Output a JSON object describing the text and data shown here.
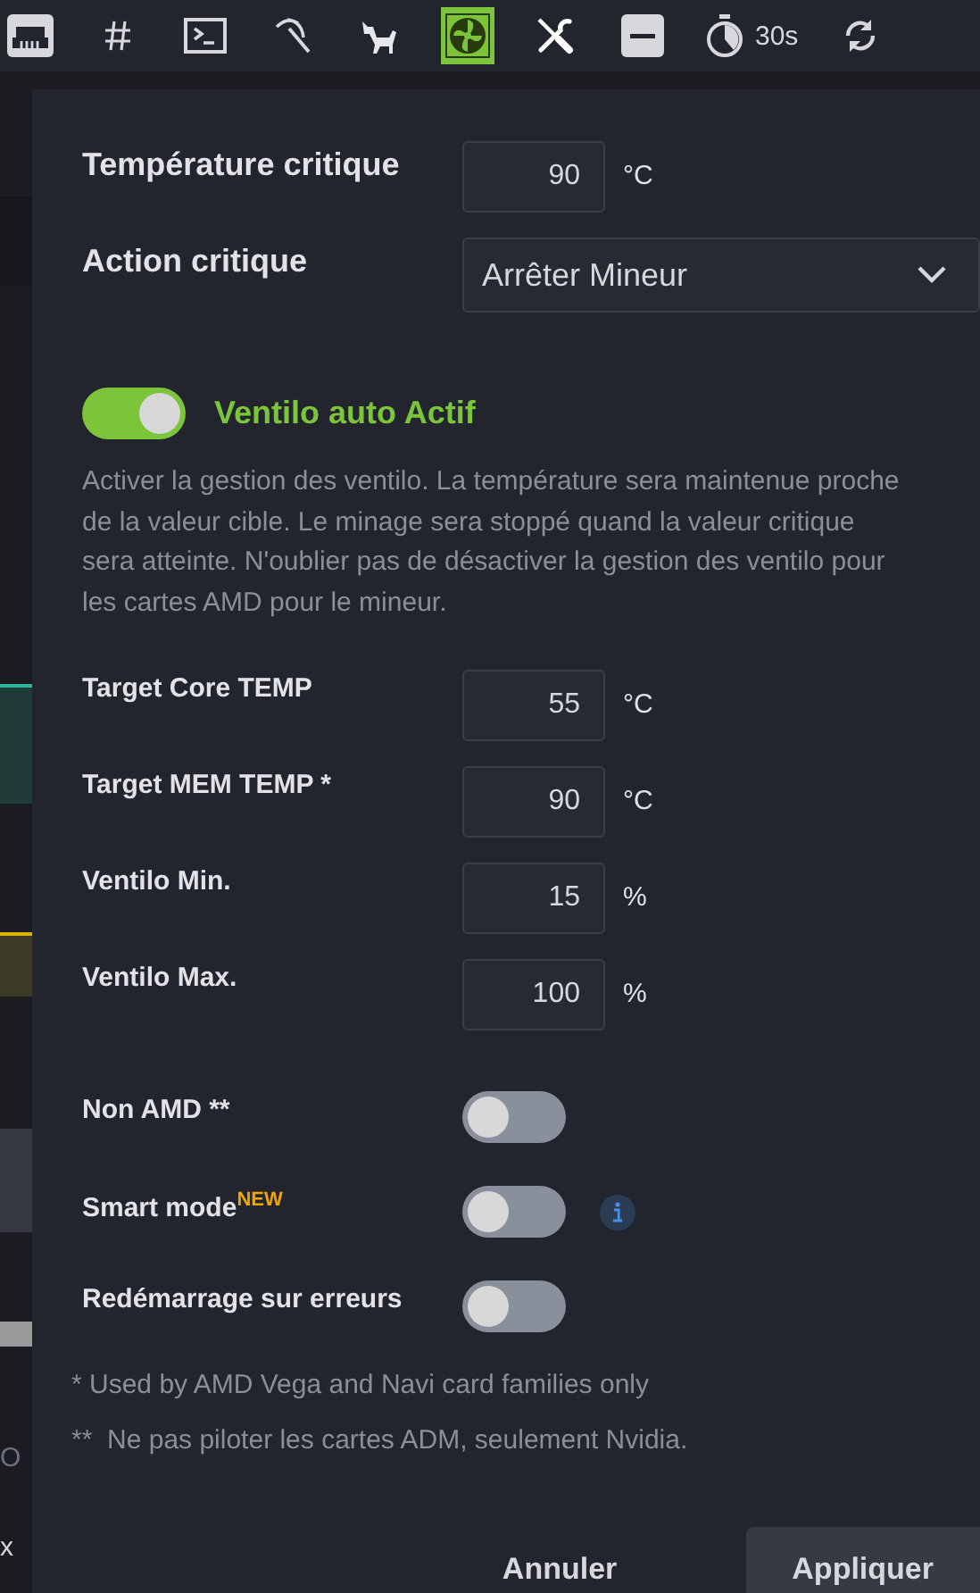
{
  "toolbar": {
    "items": [
      {
        "kind": "network",
        "selected": false
      },
      {
        "kind": "hash",
        "selected": false
      },
      {
        "kind": "terminal",
        "selected": false
      },
      {
        "kind": "pickaxe",
        "selected": false
      },
      {
        "kind": "robot-dog",
        "selected": false
      },
      {
        "kind": "fan",
        "selected": true
      },
      {
        "kind": "tools",
        "selected": false
      },
      {
        "kind": "minus",
        "selected": false
      },
      {
        "kind": "timer",
        "selected": false,
        "label": "30s"
      },
      {
        "kind": "refresh",
        "selected": false
      }
    ]
  },
  "background": {
    "texts": [
      "O",
      "x"
    ]
  },
  "dialog": {
    "fields": [
      {
        "kind": "number",
        "label": "Température critique",
        "value": "90",
        "unit": "°C"
      },
      {
        "kind": "select",
        "label": "Action critique",
        "value": "Arrêter Mineur"
      }
    ],
    "auto_fan": {
      "label": "Ventilo auto Actif",
      "on": true
    },
    "description": "Activer la gestion des ventilo. La température sera maintenue proche de la valeur cible. Le minage sera stoppé quand la valeur critique sera atteinte. N'oublier pas de désactiver la gestion des ventilo pour les cartes AMD pour le mineur.",
    "settings": [
      {
        "kind": "number",
        "label": "Target Core TEMP",
        "value": "55",
        "unit": "°C"
      },
      {
        "kind": "number",
        "label": "Target MEM TEMP *",
        "value": "90",
        "unit": "°C"
      },
      {
        "kind": "number",
        "label": "Ventilo Min.",
        "value": "15",
        "unit": "%"
      },
      {
        "kind": "number",
        "label": "Ventilo Max.",
        "value": "100",
        "unit": "%"
      },
      {
        "kind": "toggle",
        "label": "Non AMD **",
        "on": false,
        "info": false
      },
      {
        "kind": "toggle",
        "label": "Smart mode$^{NEW}$",
        "on": false,
        "info": true
      },
      {
        "kind": "toggle",
        "label": "Redémarrage sur erreurs",
        "on": false,
        "info": false
      }
    ],
    "footnotes": [
      "* Used by AMD Vega and Navi card families only",
      "**  Ne pas piloter les cartes ADM, seulement Nvidia."
    ],
    "buttons": [
      {
        "kind": "secondary",
        "label": "Annuler"
      },
      {
        "kind": "primary",
        "label": "Appliquer"
      }
    ]
  }
}
